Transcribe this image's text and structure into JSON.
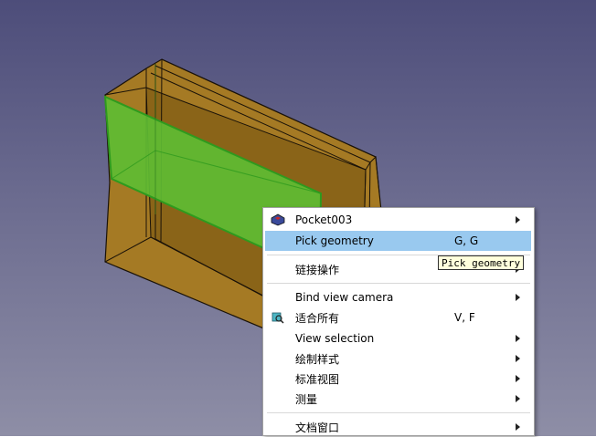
{
  "menu": {
    "items": [
      {
        "label": "Pocket003",
        "shortcut": "",
        "icon": "pocket-feature-icon",
        "submenu": true,
        "highlighted": false
      },
      {
        "label": "Pick geometry",
        "shortcut": "G, G",
        "icon": "",
        "submenu": false,
        "highlighted": true
      },
      {
        "label": "链接操作",
        "shortcut": "",
        "icon": "",
        "submenu": true,
        "highlighted": false
      },
      {
        "label": "Bind view camera",
        "shortcut": "",
        "icon": "",
        "submenu": true,
        "highlighted": false
      },
      {
        "label": "适合所有",
        "shortcut": "V, F",
        "icon": "fit-all-icon",
        "submenu": false,
        "highlighted": false
      },
      {
        "label": "View selection",
        "shortcut": "",
        "icon": "",
        "submenu": true,
        "highlighted": false
      },
      {
        "label": "绘制样式",
        "shortcut": "",
        "icon": "",
        "submenu": true,
        "highlighted": false
      },
      {
        "label": "标准视图",
        "shortcut": "",
        "icon": "",
        "submenu": true,
        "highlighted": false
      },
      {
        "label": "测量",
        "shortcut": "",
        "icon": "",
        "submenu": true,
        "highlighted": false
      },
      {
        "label": "文档窗口",
        "shortcut": "",
        "icon": "",
        "submenu": true,
        "highlighted": false
      }
    ]
  },
  "tooltip": {
    "text": "Pick geometry"
  },
  "colors": {
    "background_top": "#4d4d7a",
    "background_bottom": "#8e8ea6",
    "body_fill": "#a57a24",
    "selected_face": "#5ebc33",
    "menu_highlight": "#99c9ef"
  }
}
